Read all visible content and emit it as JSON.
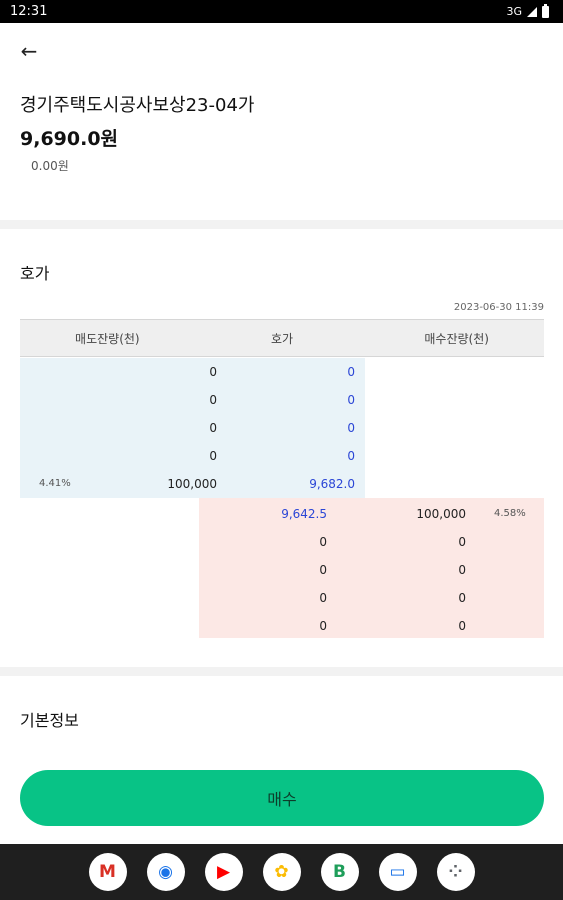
{
  "status_bar": {
    "time": "12:31",
    "network": "3G"
  },
  "stock": {
    "name": "경기주택도시공사보상23-04가",
    "price": "9,690.0원",
    "change": "0.00원"
  },
  "orderbook": {
    "title": "호가",
    "timestamp": "2023-06-30 11:39",
    "headers": [
      "매도잔량(천)",
      "호가",
      "매수잔량(천)"
    ],
    "asks": [
      {
        "qty": "0",
        "price": "0"
      },
      {
        "qty": "0",
        "price": "0"
      },
      {
        "qty": "0",
        "price": "0"
      },
      {
        "qty": "0",
        "price": "0"
      },
      {
        "qty": "100,000",
        "price": "9,682.0",
        "ratio": "4.41%"
      }
    ],
    "bids": [
      {
        "price": "9,642.5",
        "qty": "100,000",
        "ratio": "4.58%"
      },
      {
        "price": "0",
        "qty": "0"
      },
      {
        "price": "0",
        "qty": "0"
      },
      {
        "price": "0",
        "qty": "0"
      },
      {
        "price": "0",
        "qty": "0"
      }
    ]
  },
  "basic_info": {
    "title": "기본정보"
  },
  "buy_button": {
    "label": "매수"
  },
  "nav": {
    "apps": [
      {
        "name": "gmail-icon",
        "glyph": "M",
        "color": "#d93025"
      },
      {
        "name": "chrome-icon",
        "glyph": "◉",
        "color": "#1a73e8"
      },
      {
        "name": "youtube-icon",
        "glyph": "▶",
        "color": "#ff0000"
      },
      {
        "name": "photos-icon",
        "glyph": "✿",
        "color": "#fbbc04"
      },
      {
        "name": "bmessage-icon",
        "glyph": "B",
        "color": "#1e9e5a"
      },
      {
        "name": "messages-icon",
        "glyph": "▭",
        "color": "#1a73e8"
      },
      {
        "name": "app-drawer-icon",
        "glyph": "⁘",
        "color": "#5f6368"
      }
    ]
  },
  "colors": {
    "ask_bg": "#e9f3f8",
    "bid_bg": "#fce8e5",
    "price_blue": "#2b46d6",
    "buy_green": "#08c386"
  }
}
